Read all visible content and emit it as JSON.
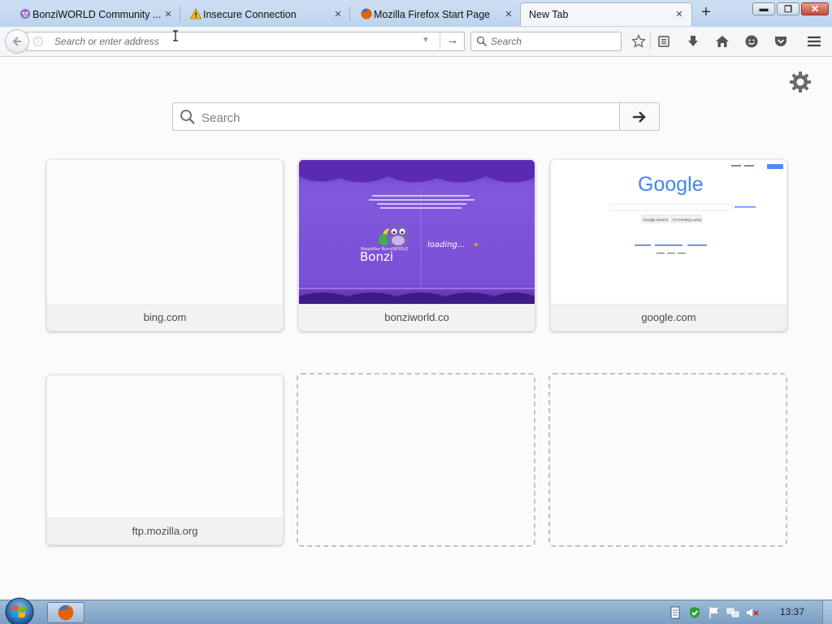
{
  "tabs": [
    {
      "label": "BonziWORLD Community ...",
      "icon": "bonzi-icon",
      "active": false
    },
    {
      "label": "Insecure Connection",
      "icon": "warning-icon",
      "active": false
    },
    {
      "label": "Mozilla Firefox Start Page",
      "icon": "firefox-icon",
      "active": false
    },
    {
      "label": "New Tab",
      "icon": "",
      "active": true
    }
  ],
  "toolbar": {
    "url_placeholder": "Search or enter address",
    "search_placeholder": "Search"
  },
  "newtab": {
    "search_placeholder": "Search",
    "tiles": [
      {
        "title": "bing.com",
        "thumbnail": "blank"
      },
      {
        "title": "bonziworld.co",
        "thumbnail": "bonzi-loading-screen"
      },
      {
        "title": "google.com",
        "thumbnail": "google-homepage"
      },
      {
        "title": "ftp.mozilla.org",
        "thumbnail": "blank"
      },
      {
        "title": "",
        "thumbnail": "empty-slot"
      },
      {
        "title": "",
        "thumbnail": "empty-slot"
      }
    ],
    "bonzi_thumb": {
      "logo_small": "MegaMan BonziWORLD",
      "logo": "Bonzi",
      "loading": "loading..."
    },
    "google_thumb": {
      "logo": "Google",
      "btn1": "Google Search",
      "btn2": "I'm Feeling Lucky",
      "signin": "Sign in"
    }
  },
  "taskbar": {
    "clock": "13:37"
  },
  "colors": {
    "tabstrip": "#c5d9ef",
    "bonzi_purple": "#7b4fd6",
    "taskbar": "#8aabcf"
  }
}
